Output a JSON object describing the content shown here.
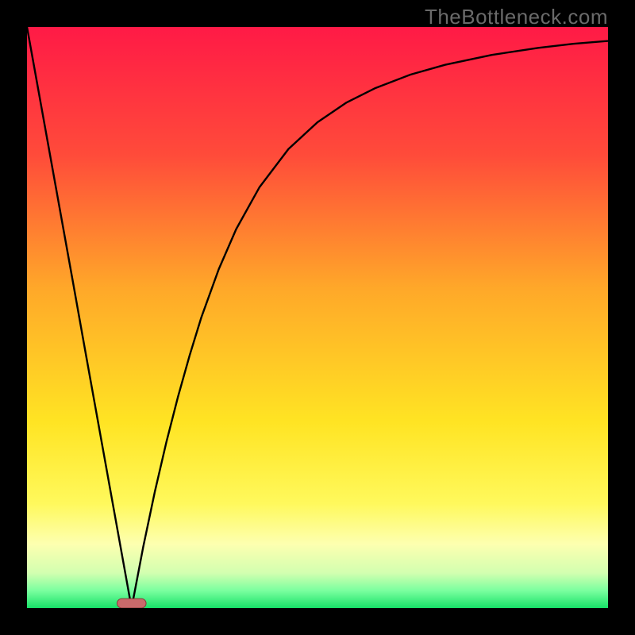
{
  "watermark": "TheBottleneck.com",
  "colors": {
    "frame": "#000000",
    "gradient_stops": [
      {
        "pct": 0,
        "color": "#ff1a46"
      },
      {
        "pct": 22,
        "color": "#ff4b3a"
      },
      {
        "pct": 45,
        "color": "#ffa829"
      },
      {
        "pct": 68,
        "color": "#ffe423"
      },
      {
        "pct": 82,
        "color": "#fff95c"
      },
      {
        "pct": 89,
        "color": "#fdffb0"
      },
      {
        "pct": 94,
        "color": "#d2ffb0"
      },
      {
        "pct": 97,
        "color": "#7bff9f"
      },
      {
        "pct": 100,
        "color": "#17e268"
      }
    ],
    "curve": "#000000",
    "marker_fill": "#c96a6b",
    "marker_stroke": "#8a3a3b"
  },
  "chart_data": {
    "type": "line",
    "title": "",
    "xlabel": "",
    "ylabel": "",
    "xlim": [
      0,
      100
    ],
    "ylim": [
      0,
      100
    ],
    "x_minimum": 18,
    "marker": {
      "x": 18,
      "y": 0,
      "width_x": 5,
      "height_y": 1.6
    },
    "series": [
      {
        "name": "bottleneck-curve",
        "x": [
          0,
          2,
          4,
          6,
          8,
          10,
          12,
          14,
          16,
          18,
          20,
          22,
          24,
          26,
          28,
          30,
          33,
          36,
          40,
          45,
          50,
          55,
          60,
          66,
          72,
          80,
          88,
          94,
          100
        ],
        "y": [
          100,
          88.9,
          77.8,
          66.7,
          55.6,
          44.4,
          33.3,
          22.2,
          11.1,
          0,
          10.5,
          20.0,
          28.6,
          36.4,
          43.5,
          50.0,
          58.3,
          65.2,
          72.4,
          79.0,
          83.6,
          87.0,
          89.5,
          91.8,
          93.5,
          95.2,
          96.4,
          97.1,
          97.6
        ]
      }
    ]
  }
}
